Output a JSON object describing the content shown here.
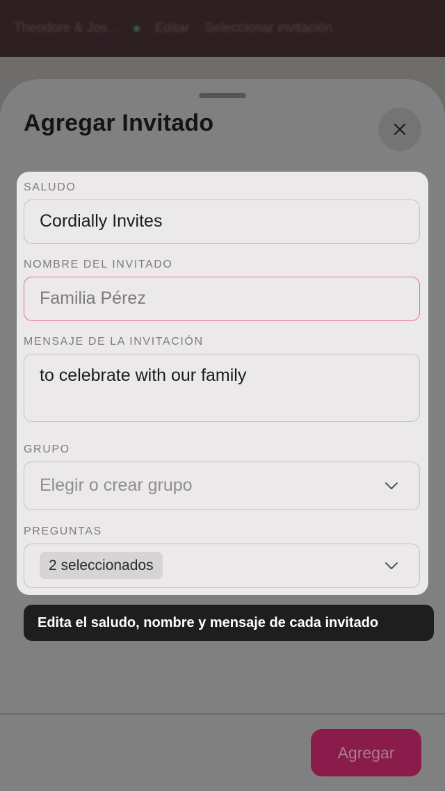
{
  "appbar": {
    "couple_name": "Theodore & Jos...",
    "edit_label": "Editar",
    "select_label": "Seleccionar invitación"
  },
  "sheet": {
    "title": "Agregar Invitado",
    "close_icon": "close-icon",
    "add_button_label": "Agregar"
  },
  "form": {
    "salutation": {
      "label": "SALUDO",
      "value": "Cordially Invites"
    },
    "guest_name": {
      "label": "NOMBRE DEL INVITADO",
      "placeholder": "Familia Pérez",
      "value": ""
    },
    "message": {
      "label": "MENSAJE DE LA INVITACIÓN",
      "value": "to celebrate with our family"
    },
    "group": {
      "label": "GRUPO",
      "placeholder": "Elegir o crear grupo"
    },
    "questions": {
      "label": "PREGUNTAS",
      "chip": "2 seleccionados"
    }
  },
  "tooltip": {
    "text": "Edita el saludo, nombre y mensaje de cada invitado"
  },
  "colors": {
    "accent": "#8a1c4b",
    "error_border": "#e6739c",
    "tooltip_bg": "#1e1e1f"
  }
}
